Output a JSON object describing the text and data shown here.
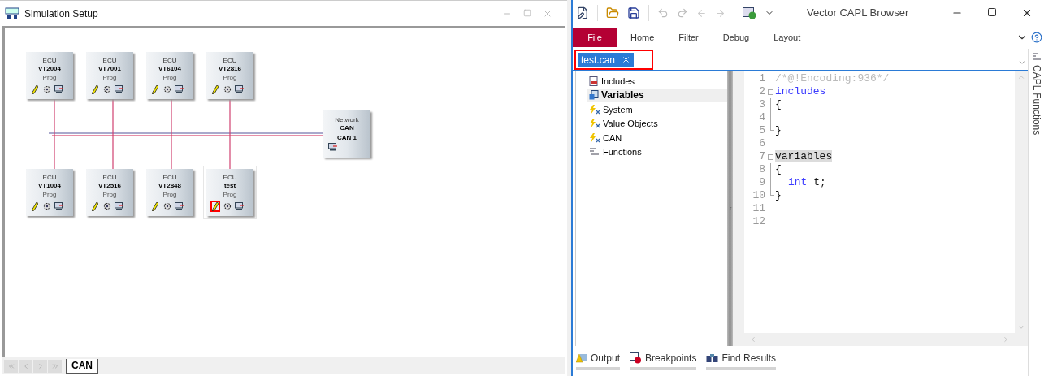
{
  "simulation_window": {
    "title": "Simulation Setup",
    "nodes": [
      {
        "type": "ECU",
        "name": "VT2004",
        "label": "Prog",
        "selected": false,
        "highlighted": false
      },
      {
        "type": "ECU",
        "name": "VT7001",
        "label": "Prog",
        "selected": false,
        "highlighted": false
      },
      {
        "type": "ECU",
        "name": "VT6104",
        "label": "Prog",
        "selected": false,
        "highlighted": false
      },
      {
        "type": "ECU",
        "name": "VT2816",
        "label": "Prog",
        "selected": false,
        "highlighted": false
      },
      {
        "type": "ECU",
        "name": "VT1004",
        "label": "Prog",
        "selected": false,
        "highlighted": false
      },
      {
        "type": "ECU",
        "name": "VT2516",
        "label": "Prog",
        "selected": false,
        "highlighted": false
      },
      {
        "type": "ECU",
        "name": "VT2848",
        "label": "Prog",
        "selected": false,
        "highlighted": false
      },
      {
        "type": "ECU",
        "name": "test",
        "label": "Prog",
        "selected": true,
        "highlighted": true
      }
    ],
    "network": {
      "type": "Network",
      "name": "CAN",
      "channel": "CAN 1"
    },
    "sheet_tabs": [
      {
        "label": "CAN",
        "selected": true
      }
    ]
  },
  "capl_browser": {
    "title": "Vector CAPL Browser",
    "ribbon": [
      {
        "label": "File",
        "kind": "menu"
      },
      {
        "label": "Home",
        "kind": "tab"
      },
      {
        "label": "Filter",
        "kind": "tab"
      },
      {
        "label": "Debug",
        "kind": "tab"
      },
      {
        "label": "Layout",
        "kind": "tab"
      }
    ],
    "doc_tabs": [
      {
        "label": "test.can",
        "selected": true,
        "highlighted": true
      }
    ],
    "tree": [
      {
        "label": "Includes",
        "kind": "includes",
        "selected": false
      },
      {
        "label": "Variables",
        "kind": "variables",
        "selected": true
      },
      {
        "label": "System",
        "kind": "event",
        "selected": false
      },
      {
        "label": "Value Objects",
        "kind": "event",
        "selected": false
      },
      {
        "label": "CAN",
        "kind": "event",
        "selected": false
      },
      {
        "label": "Functions",
        "kind": "functions",
        "selected": false
      }
    ],
    "code_lines": [
      {
        "number": "1",
        "kind": "plain",
        "tokens": [
          {
            "text": "/*@!Encoding:936*/",
            "kind": "comment"
          }
        ]
      },
      {
        "number": "2",
        "kind": "start",
        "tokens": [
          {
            "text": "includes",
            "kind": "keyword"
          }
        ]
      },
      {
        "number": "3",
        "kind": "body",
        "tokens": [
          {
            "text": "{",
            "kind": "plain"
          }
        ]
      },
      {
        "number": "4",
        "kind": "body"
      },
      {
        "number": "5",
        "kind": "end",
        "tokens": [
          {
            "text": "}",
            "kind": "plain"
          }
        ]
      },
      {
        "number": "6",
        "kind": "plain"
      },
      {
        "number": "7",
        "kind": "start",
        "tokens": [
          {
            "text": "variables",
            "kind": "marked"
          }
        ]
      },
      {
        "number": "8",
        "kind": "body",
        "tokens": [
          {
            "text": "{",
            "kind": "plain"
          }
        ]
      },
      {
        "number": "9",
        "kind": "body",
        "indented": true,
        "tokens": [
          {
            "text": "int",
            "kind": "keyword"
          },
          {
            "text": " t;",
            "kind": "plain"
          }
        ]
      },
      {
        "number": "10",
        "kind": "end",
        "tokens": [
          {
            "text": "}",
            "kind": "plain"
          }
        ]
      },
      {
        "number": "11",
        "kind": "plain"
      },
      {
        "number": "12",
        "kind": "plain"
      }
    ],
    "side_panel": "CAPL Functions",
    "bottom_tabs": [
      {
        "label": "Output",
        "kind": "output"
      },
      {
        "label": "Breakpoints",
        "kind": "breakpoints"
      },
      {
        "label": "Find Results",
        "kind": "find"
      }
    ]
  }
}
